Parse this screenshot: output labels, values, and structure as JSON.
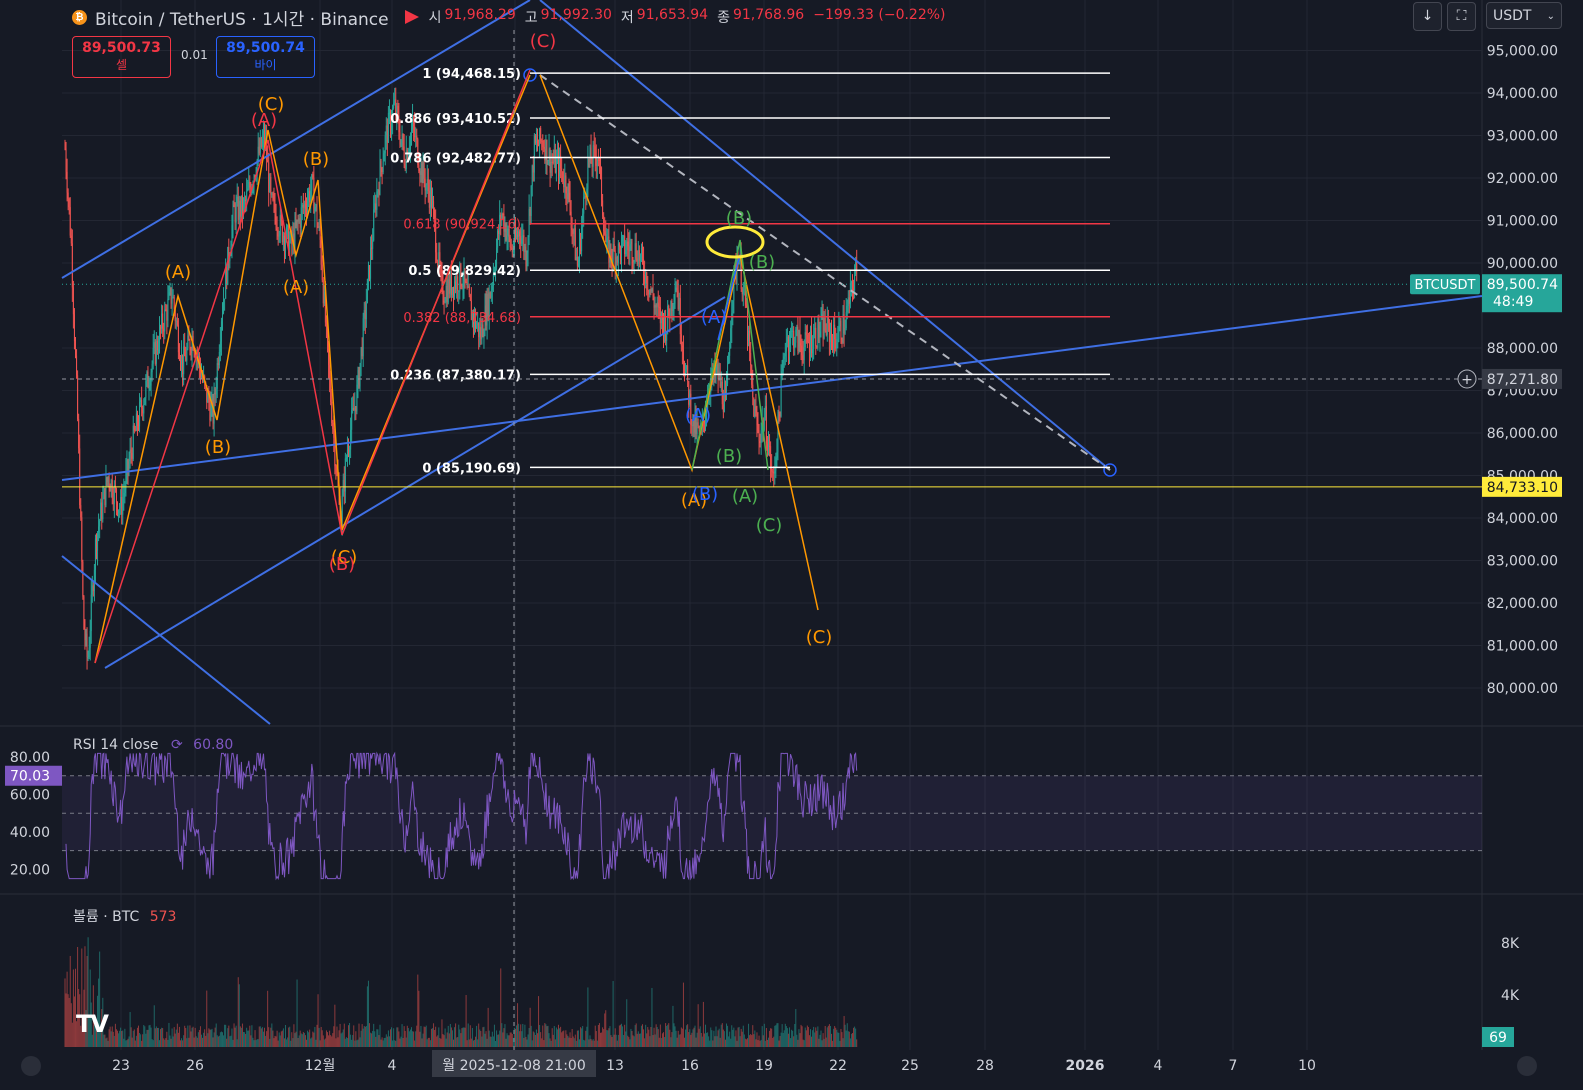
{
  "header": {
    "symbol": "Bitcoin / TetherUS · 1시간 · Binance",
    "ohlc": [
      {
        "k": "시",
        "v": "91,968.29"
      },
      {
        "k": "고",
        "v": "91,992.30"
      },
      {
        "k": "저",
        "v": "91,653.94"
      },
      {
        "k": "종",
        "v": "91,768.96"
      },
      {
        "k": "",
        "v": "−199.33 (−0.22%)"
      }
    ]
  },
  "trade": {
    "sell_price": "89,500.73",
    "sell_label": "셀",
    "qty": "0.01",
    "buy_price": "89,500.74",
    "buy_label": "바이"
  },
  "toolbar": {
    "currency": "USDT"
  },
  "colors": {
    "bg": "#161a25",
    "up": "#26a69a",
    "down": "#ef5350",
    "blue": "#2962ff",
    "trend_blue": "#3f6fe4",
    "orange": "#ff9800",
    "red": "#f23645",
    "green": "#4caf50",
    "yellow": "#ffeb3b",
    "rsi": "#7e57c2",
    "grid": "#232733"
  },
  "chart_data": [
    {
      "type": "candlestick",
      "title": "Bitcoin / TetherUS · 1시간 · Binance",
      "ylim": [
        79000,
        95900
      ],
      "y_ticks": [
        95000,
        94000,
        93000,
        92000,
        91000,
        90000,
        88000,
        87000,
        86000,
        85000,
        84000,
        83000,
        82000,
        81000,
        80000
      ],
      "y_tick_labels": [
        "95,000.00",
        "94,000.00",
        "93,000.00",
        "92,000.00",
        "91,000.00",
        "90,000.00",
        "88,000.00",
        "87,000.00",
        "86,000.00",
        "85,000.00",
        "84,000.00",
        "83,000.00",
        "82,000.00",
        "81,000.00",
        "80,000.00"
      ],
      "x_ticks": [
        "23",
        "26",
        "12월",
        "4",
        "2025-12-08",
        "13",
        "16",
        "19",
        "22",
        "25",
        "28",
        "2026",
        "4",
        "7",
        "10"
      ],
      "crosshair_date": "월 2025-12-08 21:00",
      "close_path": [
        [
          "11-20 12:00",
          92700
        ],
        [
          "11-20 18:00",
          90500
        ],
        [
          "11-21 00:00",
          86500
        ],
        [
          "11-21 06:00",
          81500
        ],
        [
          "11-21 10:00",
          80600
        ],
        [
          "11-21 18:00",
          83500
        ],
        [
          "11-22 06:00",
          85000
        ],
        [
          "11-22 18:00",
          84200
        ],
        [
          "11-23 06:00",
          85800
        ],
        [
          "11-23 20:00",
          87200
        ],
        [
          "11-24 10:00",
          88500
        ],
        [
          "11-24 20:00",
          89300
        ],
        [
          "11-25 06:00",
          87600
        ],
        [
          "11-25 16:00",
          88300
        ],
        [
          "11-26 04:00",
          87000
        ],
        [
          "11-26 12:00",
          86400
        ],
        [
          "11-26 20:00",
          88800
        ],
        [
          "11-27 08:00",
          91200
        ],
        [
          "11-27 18:00",
          91300
        ],
        [
          "11-28 04:00",
          92200
        ],
        [
          "11-28 14:00",
          93000
        ],
        [
          "11-28 20:00",
          91400
        ],
        [
          "11-29 06:00",
          90800
        ],
        [
          "11-29 16:00",
          90400
        ],
        [
          "11-30 02:00",
          91200
        ],
        [
          "11-30 12:00",
          91800
        ],
        [
          "11-30 20:00",
          90500
        ],
        [
          "12-01 04:00",
          87500
        ],
        [
          "12-01 12:00",
          85000
        ],
        [
          "12-01 16:00",
          84000
        ],
        [
          "12-01 22:00",
          85600
        ],
        [
          "12-02 08:00",
          87000
        ],
        [
          "12-02 16:00",
          88900
        ],
        [
          "12-03 02:00",
          91500
        ],
        [
          "12-03 12:00",
          93000
        ],
        [
          "12-03 20:00",
          93700
        ],
        [
          "12-04 06:00",
          92500
        ],
        [
          "12-04 14:00",
          93200
        ],
        [
          "12-04 22:00",
          92200
        ],
        [
          "12-05 08:00",
          91500
        ],
        [
          "12-05 18:00",
          89300
        ],
        [
          "12-06 04:00",
          89500
        ],
        [
          "12-06 14:00",
          89700
        ],
        [
          "12-06 22:00",
          88900
        ],
        [
          "12-07 08:00",
          88300
        ],
        [
          "12-07 18:00",
          89400
        ],
        [
          "12-08 04:00",
          91200
        ],
        [
          "12-08 14:00",
          90300
        ],
        [
          "12-08 22:00",
          90800
        ],
        [
          "12-09 04:00",
          90200
        ],
        [
          "12-09 12:00",
          92700
        ],
        [
          "12-09 20:00",
          92900
        ],
        [
          "12-10 04:00",
          92400
        ],
        [
          "12-10 12:00",
          92300
        ],
        [
          "12-10 20:00",
          91800
        ],
        [
          "12-11 06:00",
          89900
        ],
        [
          "12-11 16:00",
          92300
        ],
        [
          "12-12 02:00",
          92600
        ],
        [
          "12-12 10:00",
          90300
        ],
        [
          "12-12 18:00",
          90200
        ],
        [
          "12-13 06:00",
          90400
        ],
        [
          "12-13 16:00",
          90300
        ],
        [
          "12-14 02:00",
          89600
        ],
        [
          "12-14 12:00",
          88800
        ],
        [
          "12-14 20:00",
          88500
        ],
        [
          "12-15 06:00",
          89600
        ],
        [
          "12-15 14:00",
          87600
        ],
        [
          "12-15 22:00",
          86200
        ],
        [
          "12-16 06:00",
          85900
        ],
        [
          "12-16 14:00",
          87200
        ],
        [
          "12-16 22:00",
          87400
        ],
        [
          "12-17 06:00",
          86600
        ],
        [
          "12-17 12:00",
          89200
        ],
        [
          "12-17 18:00",
          90300
        ],
        [
          "12-18 02:00",
          88800
        ],
        [
          "12-18 08:00",
          86800
        ],
        [
          "12-18 14:00",
          85900
        ],
        [
          "12-18 20:00",
          86400
        ],
        [
          "12-19 04:00",
          84800
        ],
        [
          "12-19 10:00",
          86500
        ],
        [
          "12-19 16:00",
          88200
        ],
        [
          "12-20 00:00",
          88300
        ],
        [
          "12-20 10:00",
          88000
        ],
        [
          "12-20 20:00",
          88300
        ],
        [
          "12-21 06:00",
          88500
        ],
        [
          "12-21 16:00",
          88200
        ],
        [
          "12-22 02:00",
          88600
        ],
        [
          "12-22 12:00",
          89800
        ],
        [
          "12-22 16:00",
          89500
        ]
      ],
      "last_price": {
        "label": "BTCUSDT",
        "value": "89,500.74",
        "countdown": "48:49"
      },
      "crosshair_price": "87,271.80",
      "horizontal_line": {
        "value": 84733.1,
        "label": "84,733.10"
      },
      "fibonacci": [
        {
          "level": "1",
          "price": "94,468.15",
          "value": 94468.15
        },
        {
          "level": "0.886",
          "price": "93,410.52",
          "value": 93410.52
        },
        {
          "level": "0.786",
          "price": "92,482.77",
          "value": 92482.77
        },
        {
          "level": "0.618",
          "price": "90,924.16",
          "value": 90924.16
        },
        {
          "level": "0.5",
          "price": "89,829.42",
          "value": 89829.42
        },
        {
          "level": "0.382",
          "price": "88,734.68",
          "value": 88734.68
        },
        {
          "level": "0.236",
          "price": "87,380.17",
          "value": 87380.17
        },
        {
          "level": "0",
          "price": "85,190.69",
          "value": 85190.69
        }
      ],
      "wave_labels": [
        "(A)",
        "(B)",
        "(C)"
      ]
    },
    {
      "type": "line",
      "title": "RSI 14 close",
      "value_label": "60.80",
      "current": "70.03",
      "ylim": [
        10,
        85
      ],
      "y_ticks": [
        "80.00",
        "60.00",
        "40.00",
        "20.00"
      ],
      "band": [
        30,
        70
      ]
    },
    {
      "type": "bar",
      "title": "볼륨 · BTC",
      "value_label": "573",
      "current": "69",
      "y_ticks": [
        "8K",
        "4K"
      ]
    }
  ]
}
